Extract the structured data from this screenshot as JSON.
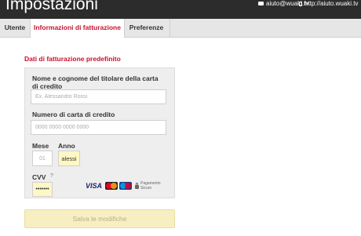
{
  "header": {
    "title": "Impostazioni",
    "email": "aiuto@wuaki.tv",
    "help_url": "http://aiuto.wuaki.tv"
  },
  "tabs": [
    {
      "label": "Utente"
    },
    {
      "label": "Informazioni di fatturazione",
      "active": true
    },
    {
      "label": "Preferenze"
    }
  ],
  "billing": {
    "section_title": "Dati di fatturazione predefinito",
    "name_label": "Nome e cognome del titolare della carta di credito",
    "name_placeholder": "Ex. Alessandro Rossi",
    "card_label": "Numero di carta di credito",
    "card_placeholder": "0000 0000 0000 0000",
    "month_label": "Mese",
    "month_placeholder": "01",
    "year_label": "Anno",
    "year_value": "alessi",
    "cvv_label": "CVV",
    "cvv_help": "?",
    "cvv_value": "•••••••",
    "card_brand_visa": "VISA",
    "secure_payment": "Pagamento Sicuro"
  },
  "save_button": "Salva le modifiche",
  "colors": {
    "accent": "#c8102e",
    "header_bg": "#2c2c2c",
    "autofill_bg": "#fff7c4",
    "disabled_button_bg": "#f7efc2"
  }
}
